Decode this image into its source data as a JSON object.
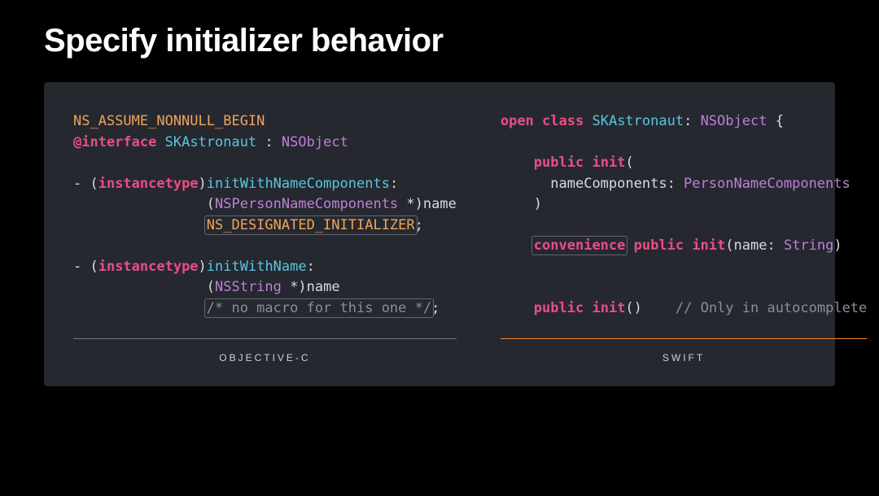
{
  "title": "Specify initializer behavior",
  "left": {
    "label": "OBJECTIVE-C",
    "ns_assume": "NS_ASSUME_NONNULL_BEGIN",
    "at_interface": "@interface",
    "class_name": "SKAstronaut",
    "super_sep": " : ",
    "super_name": "NSObject",
    "dash": "- (",
    "instancetype": "instancetype",
    "close_paren": ")",
    "m1_name": "initWithNameComponents",
    "m1_colon": ":",
    "m1_line2a": "                (",
    "m1_argtype": "NSPersonNameComponents",
    "m1_star_close": " *)",
    "m1_argname": "name",
    "m1_line3a": "                ",
    "m1_designated": "NS_DESIGNATED_INITIALIZER",
    "m1_semi": ";",
    "m2_name": "initWithName",
    "m2_colon": ":",
    "m2_line2a": "                (",
    "m2_argtype": "NSString",
    "m2_star_close": " *)",
    "m2_argname": "name",
    "m2_line3a": "                ",
    "m2_comment": "/* no macro for this one */",
    "m2_semi": ";"
  },
  "right": {
    "label": "SWIFT",
    "open": "open",
    "class_kw": "class",
    "class_name": "SKAstronaut",
    "colon": ": ",
    "super_name": "NSObject",
    "brace": " {",
    "indent": "    ",
    "public": "public",
    "init_kw": "init",
    "lparen": "(",
    "rparen": ")",
    "arg1_indent": "      ",
    "arg1_name": "nameComponents",
    "arg1_sep": ": ",
    "arg1_type": "PersonNameComponents",
    "convenience": "convenience",
    "space": " ",
    "arg2_name": "name",
    "arg2_sep": ": ",
    "arg2_type": "String",
    "init3_gap": "    ",
    "comment": "// Only in autocomplete"
  }
}
